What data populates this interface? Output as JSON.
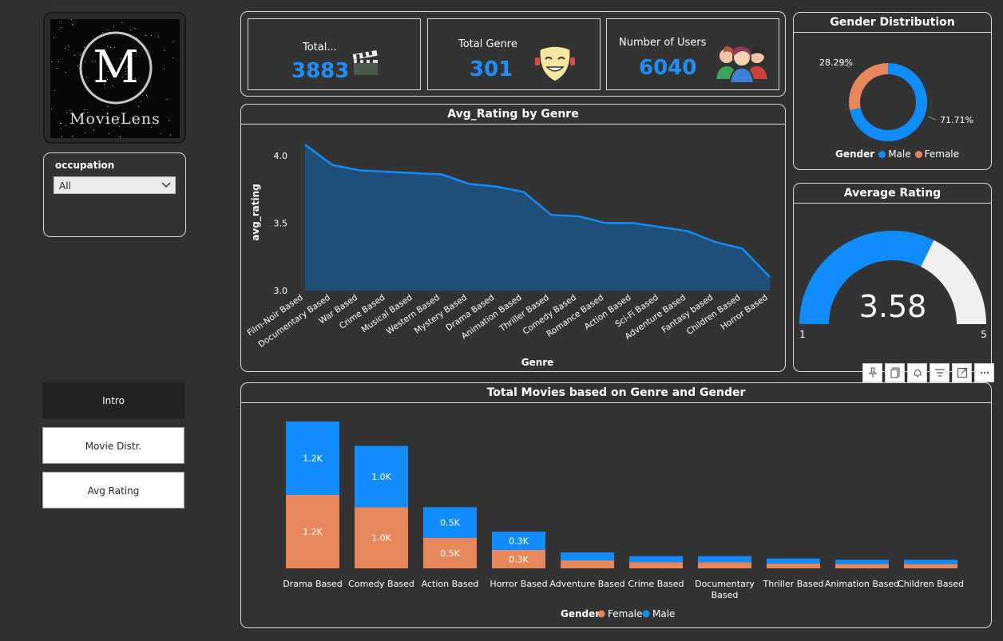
{
  "logo": {
    "letter": "M",
    "text": "MovieLens"
  },
  "slicer": {
    "label": "occupation",
    "value": "All"
  },
  "nav": {
    "intro": "Intro",
    "movie_distr": "Movie Distr.",
    "avg_rating": "Avg Rating"
  },
  "kpis": [
    {
      "label": "Total...",
      "value": "3883",
      "icon": "clapperboard-icon"
    },
    {
      "label": "Total Genre",
      "value": "301",
      "icon": "theater-mask-icon"
    },
    {
      "label": "Number of Users",
      "value": "6040",
      "icon": "users-group-icon"
    }
  ],
  "colors": {
    "accent_blue": "#118DFF",
    "female_orange": "#E8875B",
    "area_fill": "#1F4E79",
    "panel_bg": "#333333",
    "page_bg": "#303030"
  },
  "gender_distribution": {
    "title": "Gender Distribution",
    "legend_title": "Gender",
    "chart_data": {
      "type": "pie",
      "donut": true,
      "categories": [
        "Male",
        "Female"
      ],
      "values": [
        71.71,
        28.29
      ],
      "labels": [
        "71.71%",
        "28.29%"
      ],
      "legend": "bottom"
    }
  },
  "avg_rating_by_genre": {
    "title": "Avg_Rating by Genre",
    "chart_data": {
      "type": "area",
      "xlabel": "Genre",
      "ylabel": "avg_rating",
      "ylim": [
        3.0,
        4.2
      ],
      "yticks": [
        "3.0",
        "3.5",
        "4.0"
      ],
      "categories": [
        "Film-Noir Based",
        "Documentary Based",
        "War Based",
        "Crime Based",
        "Musical Based",
        "Western Based",
        "Mystery Based",
        "Drama Based",
        "Animation Based",
        "Thriller Based",
        "Comedy Based",
        "Romance Based",
        "Action Based",
        "Sci-Fi Based",
        "Adventure Based",
        "Fantasy based",
        "Children Based",
        "Horror Based"
      ],
      "values": [
        4.08,
        3.93,
        3.89,
        3.88,
        3.87,
        3.86,
        3.79,
        3.77,
        3.73,
        3.56,
        3.55,
        3.5,
        3.5,
        3.47,
        3.44,
        3.36,
        3.31,
        3.1
      ]
    }
  },
  "average_rating": {
    "title": "Average Rating",
    "value_label": "3.58",
    "chart_data": {
      "type": "gauge",
      "value": 3.58,
      "min": 1,
      "max": 5,
      "min_label": "1",
      "max_label": "5"
    }
  },
  "movies_by_genre_gender": {
    "title": "Total Movies based on Genre and Gender",
    "legend_title": "Gender",
    "chart_data": {
      "type": "bar",
      "stacked": true,
      "categories": [
        "Drama Based",
        "Comedy Based",
        "Action Based",
        "Horror Based",
        "Adventure Based",
        "Crime Based",
        "Documentary Based",
        "Thriller Based",
        "Animation Based",
        "Children Based"
      ],
      "series": [
        {
          "name": "Female",
          "values": [
            1200,
            1000,
            500,
            300,
            130,
            100,
            100,
            80,
            70,
            70
          ],
          "labels": [
            "1.2K",
            "1.0K",
            "0.5K",
            "0.3K",
            "",
            "",
            "",
            "",
            "",
            ""
          ]
        },
        {
          "name": "Male",
          "values": [
            1200,
            1000,
            500,
            300,
            130,
            100,
            100,
            80,
            70,
            70
          ],
          "labels": [
            "1.2K",
            "1.0K",
            "0.5K",
            "0.3K",
            "",
            "",
            "",
            "",
            "",
            ""
          ]
        }
      ],
      "legend": "bottom"
    }
  },
  "toolbar": [
    "pin-icon",
    "copy-icon",
    "bell-icon",
    "filter-icon",
    "focus-mode-icon",
    "more-options-icon"
  ]
}
